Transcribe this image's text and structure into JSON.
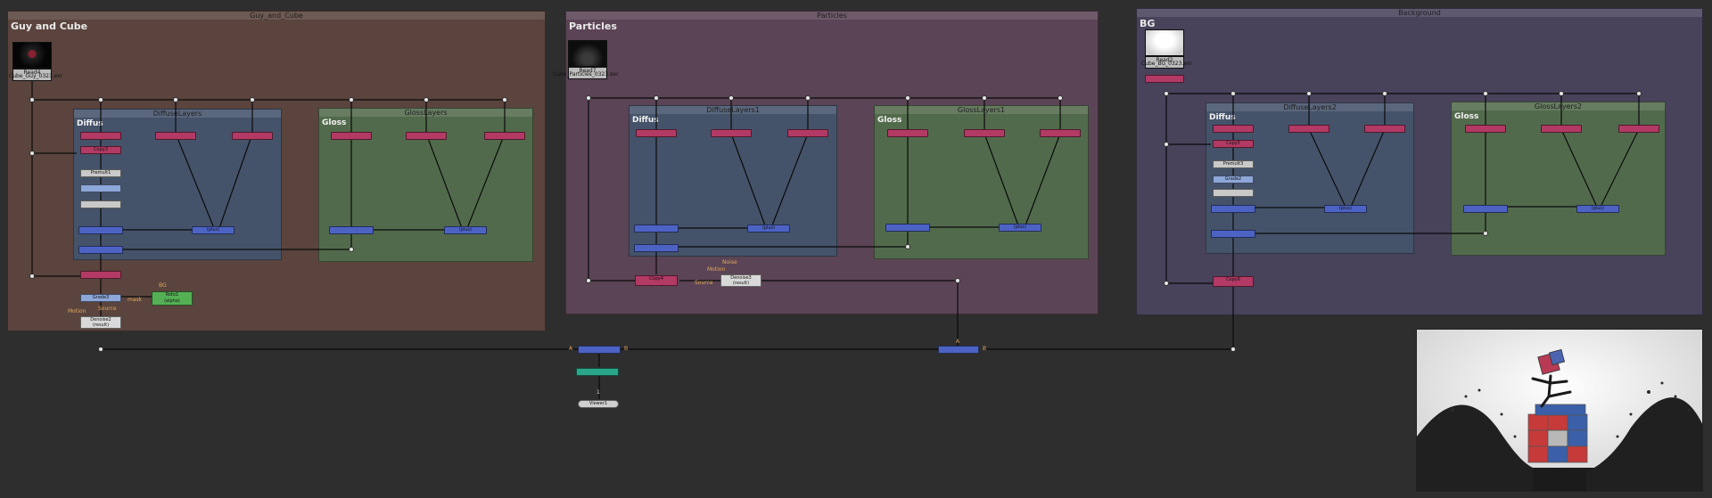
{
  "backdrops": {
    "guy": {
      "title": "Guy_and_Cube",
      "label": "Guy and Cube"
    },
    "particles": {
      "title": "Particles",
      "label": "Particles"
    },
    "background": {
      "title": "Background",
      "label": "BG"
    },
    "diffuse1": {
      "title": "DiffuseLayers",
      "label": "Diffus"
    },
    "gloss1": {
      "title": "GlossLayers",
      "label": "Gloss"
    },
    "diffuse2": {
      "title": "DiffuseLayers1",
      "label": "Diffus"
    },
    "gloss2": {
      "title": "GlossLayers1",
      "label": "Gloss"
    },
    "diffuse3": {
      "title": "DiffuseLayers2",
      "label": "Diffus"
    },
    "gloss3": {
      "title": "GlossLayers2",
      "label": "Gloss"
    }
  },
  "reads": {
    "read4": {
      "label": "Read4",
      "file": "Cube_Guy_0323.exr"
    },
    "read7": {
      "label": "Read7",
      "file": "Cube_Particles_0323.exr"
    },
    "read2": {
      "label": "Read2",
      "file": "Cube_BG_0323.exr"
    }
  },
  "nodes": {
    "copy3": "Copy3",
    "premult1": "Premult1",
    "grade3": "Grade3",
    "copy5": "Copy5",
    "premult3": "Premult3",
    "grade2": "Grade2",
    "copy4": "Copy4",
    "copy6": "Copy6",
    "roto1": "Roto1",
    "roto1_sub": "(alpha)",
    "denoise2": "Denoise2",
    "denoise2_sub": "(result)",
    "denoise3": "Denoise3",
    "denoise3_sub": "(result)",
    "viewer": "Viewer1",
    "plus": "(plus)"
  },
  "edge_labels": {
    "motion": "Motion",
    "source": "Source",
    "noise": "Noise",
    "mask": "mask",
    "bg": "BG",
    "a": "A",
    "b": "B",
    "one": "1"
  },
  "colors": {
    "guy_backdrop": "#5a443d",
    "particles_backdrop": "#5b4455",
    "background_backdrop": "#48425a",
    "diffuse_backdrop": "#45536a",
    "gloss_backdrop": "#526a4c"
  }
}
